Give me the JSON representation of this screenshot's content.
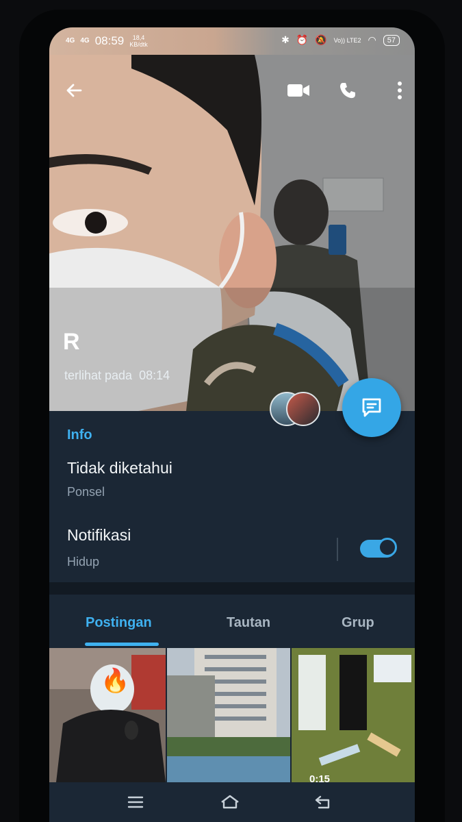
{
  "status_bar": {
    "signal_1": "4G",
    "signal_2": "4G",
    "time": "08:59",
    "data_rate_value": "18,4",
    "data_rate_unit": "KB/dtk",
    "network": "Vo)) LTE2",
    "battery": "57"
  },
  "profile": {
    "name": "R",
    "last_seen_label": "terlihat pada",
    "last_seen_time": "08:14"
  },
  "info": {
    "title": "Info",
    "phone_value": "Tidak diketahui",
    "phone_label": "Ponsel",
    "notifications_value": "Notifikasi",
    "notifications_label": "Hidup",
    "notifications_on": true
  },
  "tabs": [
    {
      "label": "Postingan",
      "active": true
    },
    {
      "label": "Tautan",
      "active": false
    },
    {
      "label": "Grup",
      "active": false
    }
  ],
  "media": {
    "video_duration": "0:15"
  },
  "colors": {
    "accent": "#3fb1f0",
    "panel": "#1b2735",
    "fab": "#34a6e6"
  },
  "icons": [
    "back-arrow-icon",
    "video-call-icon",
    "phone-icon",
    "more-vert-icon",
    "message-icon",
    "menu-icon",
    "home-icon",
    "back-nav-icon",
    "fire-emoji-icon"
  ]
}
